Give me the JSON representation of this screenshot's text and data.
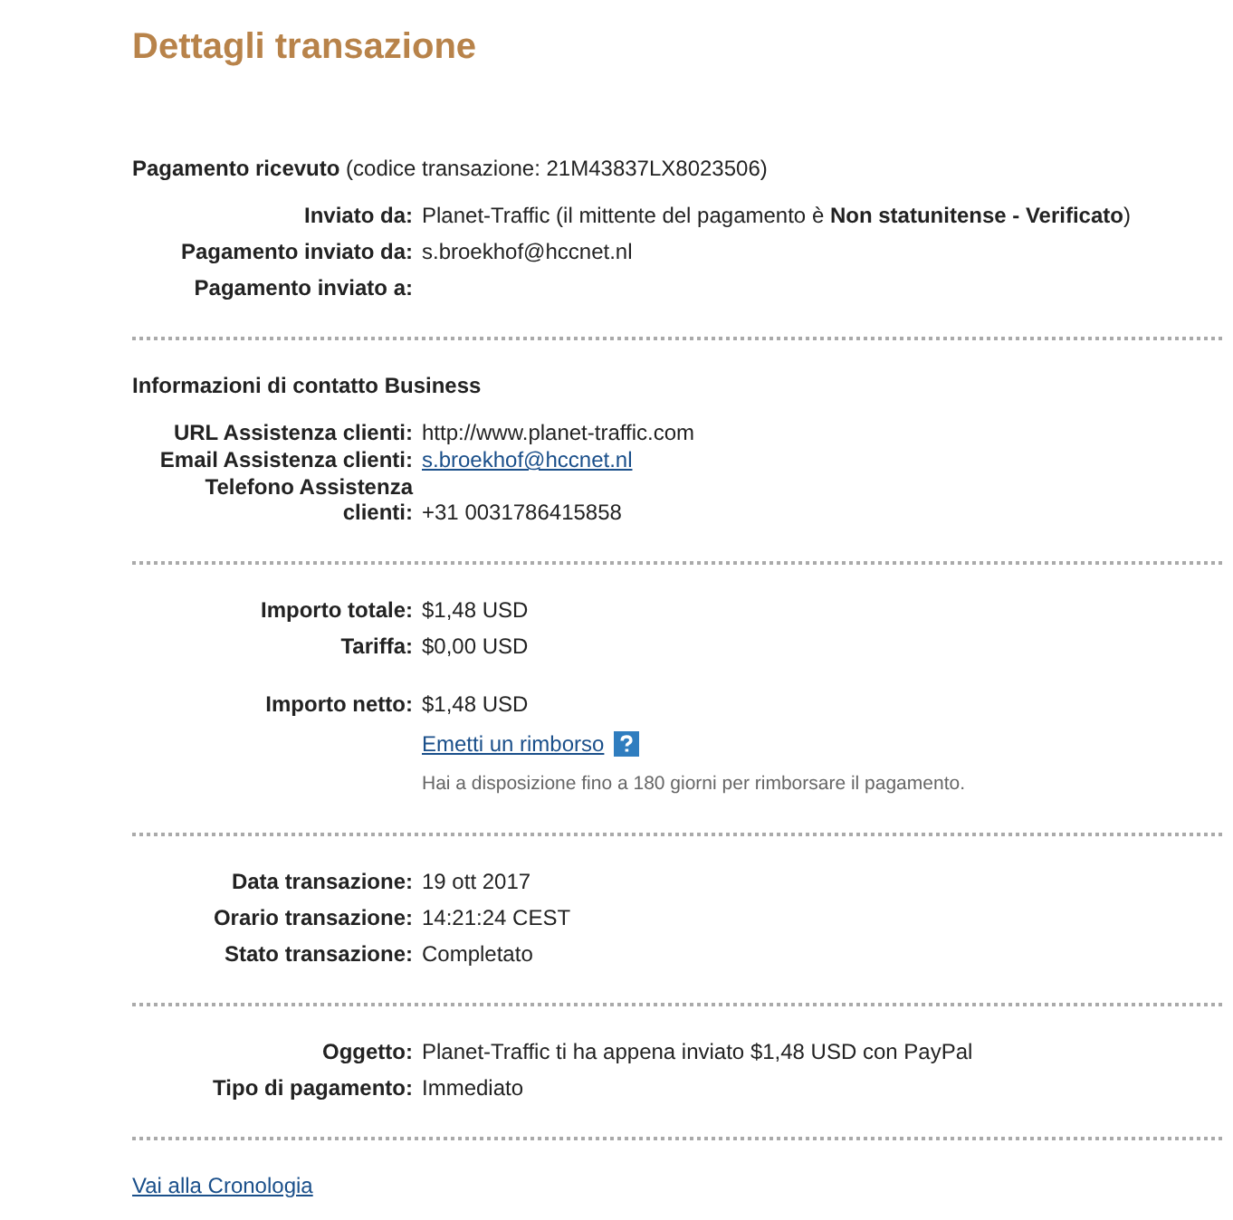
{
  "title": "Dettagli transazione",
  "sections": [
    {
      "heading": "**Pagamento ricevuto** (codice transazione: 21M43837LX8023506)",
      "groups": [
        [
          {
            "label": "Inviato da:",
            "value": "Planet-Traffic (il mittente del pagamento è **Non statunitense - Verificato**)",
            "kind": "text"
          },
          {
            "label": "Pagamento inviato da:",
            "value": "s.broekhof@hccnet.nl",
            "kind": "text"
          },
          {
            "label": "Pagamento inviato a:"
          }
        ]
      ]
    },
    {
      "heading": "**Informazioni di contatto Business**",
      "groups": [
        [
          {
            "label": "URL Assistenza clienti:",
            "value": "http://www.planet-traffic.com",
            "kind": "text",
            "tight": true
          },
          {
            "label": "Email Assistenza clienti:",
            "value": "s.broekhof@hccnet.nl",
            "kind": "link",
            "tight": true
          },
          {
            "label": "Telefono Assistenza clienti:",
            "value": "+31 0031786415858",
            "kind": "text"
          }
        ]
      ]
    },
    {
      "groups": [
        [
          {
            "label": "Importo totale:",
            "value": "$1,48 USD",
            "kind": "text"
          },
          {
            "label": "Tariffa:",
            "value": "$0,00 USD",
            "kind": "text"
          }
        ],
        [
          {
            "label": "Importo netto:",
            "value": "$1,48 USD",
            "kind": "text",
            "link": "Emetti un rimborso",
            "note": "Hai a disposizione fino a 180 giorni per rimborsare il pagamento."
          }
        ]
      ]
    },
    {
      "groups": [
        [
          {
            "label": "Data transazione:",
            "value": "19 ott 2017",
            "kind": "text"
          },
          {
            "label": "Orario transazione:",
            "value": "14:21:24 CEST",
            "kind": "text"
          },
          {
            "label": "Stato transazione:",
            "value": "Completato",
            "kind": "text"
          }
        ]
      ]
    },
    {
      "groups": [
        [
          {
            "label": "Oggetto:",
            "value": "Planet-Traffic ti ha appena inviato $1,48 USD con PayPal",
            "kind": "text"
          },
          {
            "label": "Tipo di pagamento:",
            "value": "Immediato",
            "kind": "text"
          }
        ]
      ]
    }
  ],
  "footer_link": "Vai alla Cronologia"
}
